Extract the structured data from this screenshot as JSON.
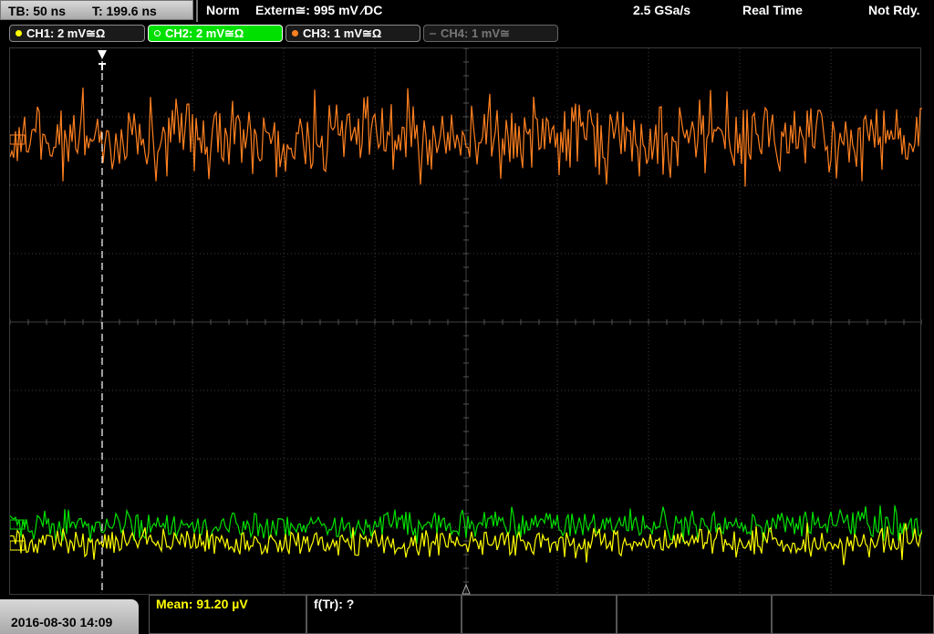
{
  "header": {
    "timebase": "TB: 50 ns",
    "trigger_time": "T: 199.6 ns",
    "mode": "Norm",
    "trigger_source": "Extern≅: 995 mV ⁄DC",
    "sample_rate": "2.5 GSa/s",
    "acq_mode": "Real Time",
    "status": "Not Rdy."
  },
  "channels": [
    {
      "label": "CH1: 2 mV≅Ω",
      "color": "#ffff00",
      "active": false
    },
    {
      "label": "CH2: 2 mV≅Ω",
      "color": "#00e000",
      "active": true
    },
    {
      "label": "CH3: 1 mV≅Ω",
      "color": "#ff8020",
      "active": false
    },
    {
      "label": "CH4: 1 mV≅",
      "color": "#888888",
      "active": false
    }
  ],
  "footer": {
    "datetime": "2016-08-30 14:09",
    "measurement_1": "Mean: 91.20 µV",
    "measurement_2": "f(Tr): ?"
  },
  "colors": {
    "ch1": "#ffff00",
    "ch2": "#00e000",
    "ch3": "#ff8020",
    "grid": "#404040",
    "trigger_marker": "#ffffff"
  },
  "icons": {
    "trigger_position": "trigger-T-marker",
    "center_marker": "triangle-up-icon"
  }
}
